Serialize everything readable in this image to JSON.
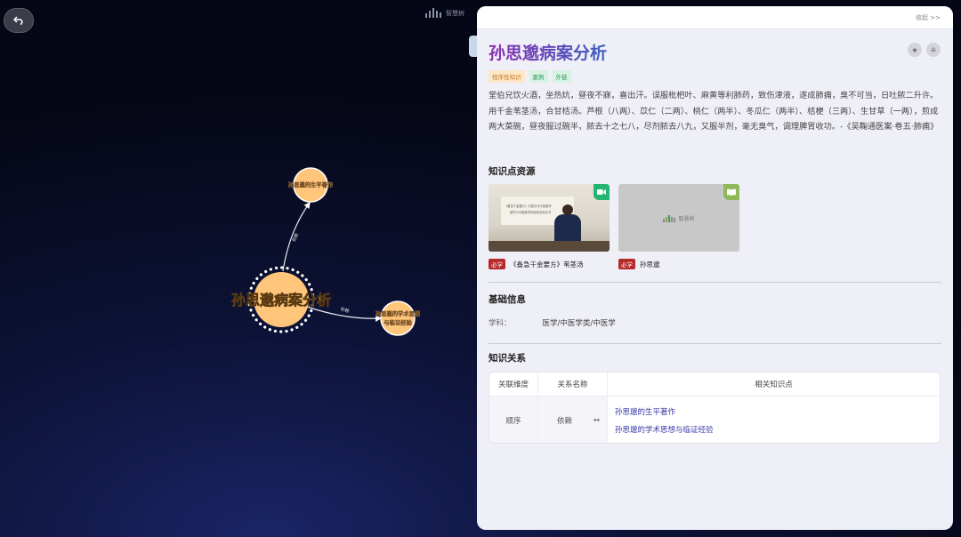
{
  "header": {
    "back_icon": "undo-arrow-icon",
    "logo_text": "智慧树"
  },
  "graph": {
    "center_node": "孙思邈病案分析",
    "nodes": [
      {
        "label": "孙思邈的生平著作"
      },
      {
        "label_line1": "孙思邈的学术思想",
        "label_line2": "与临证经验"
      }
    ],
    "edge_labels": [
      "依赖",
      "依赖"
    ],
    "colors": {
      "node_fill": "#ffc57a",
      "node_border": "#ffffff"
    }
  },
  "panel": {
    "collapse_label": "收起 >>",
    "title": "孙思邈病案分析",
    "icons": [
      "star-icon",
      "grid-icon"
    ],
    "tags": [
      "程序性知识",
      "案例",
      "外链"
    ],
    "description": "堂伯兄饮火酒，坐热炕，昼夜不寐，喜出汗。误服枇杷叶、麻黄等利肺药，致伤津液，遂成肺痈，臭不可当，日吐脓二升许。用千金苇茎汤，合甘桔汤。芦根（八两）、苡仁（二两）、桃仁（两半）、冬瓜仁（两半）、桔梗（三两）、生甘草（一两），煎成两大菜碗，昼夜服过碗半，脓去十之七八，尽剂脓去八九，又服半剂，毫无臭气，调理脾胃收功。-《吴鞠通医案·卷五·肺痈》",
    "resources_heading": "知识点资源",
    "resources": [
      {
        "type_icon": "video-camera-icon",
        "must_label": "必学",
        "title": "《备急千金要方》苇茎汤",
        "thumb_text_1": "《备急千金要方》中国古代中医著作",
        "thumb_text_2": "被誉为中国最早的临床百科全书"
      },
      {
        "type_icon": "book-icon",
        "must_label": "必学",
        "title": "孙思邈",
        "thumb_logo": "智慧树"
      }
    ],
    "basic_info_heading": "基础信息",
    "subject_label": "学科：",
    "subject_value": "医学/中医学类/中医学",
    "relations_heading": "知识关系",
    "relations_table": {
      "headers": [
        "关联维度",
        "关系名称",
        "相关知识点"
      ],
      "row": {
        "dimension": "顺序",
        "relation": "依赖",
        "arrow": "↔",
        "related": [
          "孙思邈的生平著作",
          "孙思邈的学术思想与临证经验"
        ]
      }
    }
  }
}
